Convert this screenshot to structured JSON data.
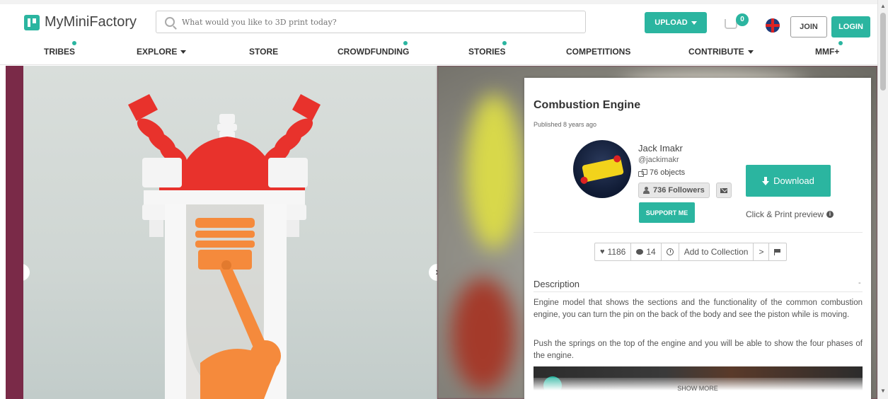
{
  "header": {
    "logo_text": "MyMiniFactory",
    "search_placeholder": "What would you like to 3D print today?",
    "upload_label": "UPLOAD",
    "cart_count": "0",
    "join_label": "JOIN",
    "login_label": "LOGIN"
  },
  "nav": {
    "items": [
      {
        "label": "TRIBES",
        "dot": true,
        "caret": false
      },
      {
        "label": "EXPLORE",
        "dot": false,
        "caret": true
      },
      {
        "label": "STORE",
        "dot": false,
        "caret": false
      },
      {
        "label": "CROWDFUNDING",
        "dot": true,
        "caret": false
      },
      {
        "label": "STORIES",
        "dot": true,
        "caret": false
      },
      {
        "label": "COMPETITIONS",
        "dot": false,
        "caret": false
      },
      {
        "label": "CONTRIBUTE",
        "dot": false,
        "caret": true
      },
      {
        "label": "MMF+",
        "dot": true,
        "caret": false
      }
    ]
  },
  "object": {
    "title": "Combustion Engine",
    "published": "Published 8 years ago",
    "designer": {
      "name": "Jack Imakr",
      "handle": "@jackimakr",
      "objects": "76 objects",
      "followers": "736 Followers"
    },
    "support_label": "SUPPORT ME",
    "download_label": "Download",
    "preview_label": "Click & Print preview",
    "stats": {
      "likes": "1186",
      "comments": "14",
      "add_to_collection": "Add to Collection"
    },
    "description": {
      "heading": "Description",
      "collapse": "-",
      "paragraphs": [
        "Engine model that shows the sections and the functionality of the common combustion engine, you can turn the pin on the back of the body and see the piston while is moving.",
        "Push the springs on the top of the engine and you will be able to show the four phases of the engine."
      ],
      "show_more": "SHOW MORE"
    }
  },
  "colors": {
    "accent": "#2bb5a0",
    "engine_red": "#e8322c",
    "engine_orange": "#f58a3c"
  }
}
